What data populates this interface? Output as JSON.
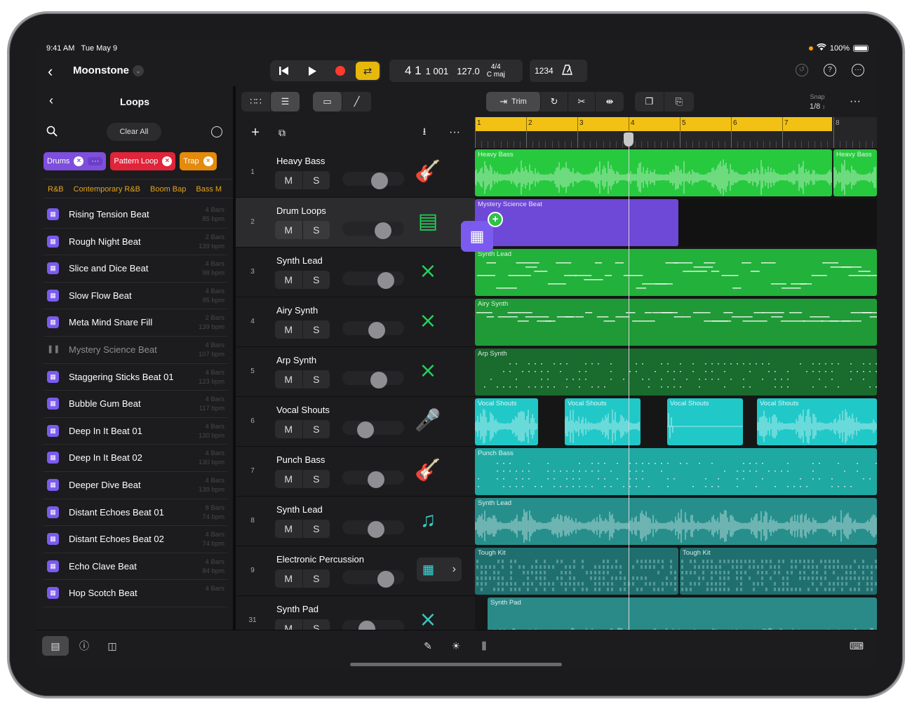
{
  "status": {
    "time": "9:41 AM",
    "date": "Tue May 9",
    "battery": "100%"
  },
  "project": {
    "title": "Moonstone"
  },
  "lcd": {
    "position": "4 1",
    "ticks": "1 001",
    "tempo": "127.0",
    "time_sig": "4/4",
    "key": "C maj"
  },
  "count_in": "1234",
  "browser": {
    "title": "Loops",
    "clear_label": "Clear All",
    "tags": [
      {
        "label": "Drums",
        "color": "#7d4fdc"
      },
      {
        "label": "Pattern Loop",
        "color": "#e0243a"
      },
      {
        "label": "Trap",
        "color": "#e48a0c"
      }
    ],
    "genres": [
      "R&B",
      "Contemporary R&B",
      "Boom Bap",
      "Bass M"
    ],
    "loops": [
      {
        "name": "Rising Tension Beat",
        "bars": "4 Bars",
        "bpm": "85 bpm"
      },
      {
        "name": "Rough Night Beat",
        "bars": "2 Bars",
        "bpm": "139 bpm"
      },
      {
        "name": "Slice and Dice Beat",
        "bars": "4 Bars",
        "bpm": "98 bpm"
      },
      {
        "name": "Slow Flow Beat",
        "bars": "4 Bars",
        "bpm": "95 bpm"
      },
      {
        "name": "Meta Mind Snare Fill",
        "bars": "2 Bars",
        "bpm": "139 bpm"
      },
      {
        "name": "Mystery Science Beat",
        "bars": "4 Bars",
        "bpm": "107 bpm",
        "playing": true
      },
      {
        "name": "Staggering Sticks Beat 01",
        "bars": "4 Bars",
        "bpm": "123 bpm"
      },
      {
        "name": "Bubble Gum Beat",
        "bars": "4 Bars",
        "bpm": "117 bpm"
      },
      {
        "name": "Deep In It Beat 01",
        "bars": "4 Bars",
        "bpm": "130 bpm"
      },
      {
        "name": "Deep In It Beat 02",
        "bars": "4 Bars",
        "bpm": "130 bpm"
      },
      {
        "name": "Deeper Dive Beat",
        "bars": "4 Bars",
        "bpm": "139 bpm"
      },
      {
        "name": "Distant Echoes Beat 01",
        "bars": "8 Bars",
        "bpm": "74 bpm"
      },
      {
        "name": "Distant Echoes Beat 02",
        "bars": "4 Bars",
        "bpm": "74 bpm"
      },
      {
        "name": "Echo Clave Beat",
        "bars": "4 Bars",
        "bpm": "84 bpm"
      },
      {
        "name": "Hop Scotch Beat",
        "bars": "4 Bars",
        "bpm": ""
      }
    ]
  },
  "toolbar": {
    "trim_label": "Trim",
    "snap_label": "Snap",
    "snap_value": "1/8"
  },
  "tracks": [
    {
      "num": "1",
      "name": "Heavy Bass",
      "icon": "bass-guitar-icon",
      "vol": 0.6
    },
    {
      "num": "2",
      "name": "Drum Loops",
      "icon": "drum-machine-icon",
      "vol": 0.66
    },
    {
      "num": "3",
      "name": "Synth Lead",
      "icon": "keyboard-stand-icon",
      "vol": 0.7
    },
    {
      "num": "4",
      "name": "Airy Synth",
      "icon": "keyboard-stand-icon",
      "vol": 0.56
    },
    {
      "num": "5",
      "name": "Arp Synth",
      "icon": "keyboard-stand-icon",
      "vol": 0.59
    },
    {
      "num": "6",
      "name": "Vocal Shouts",
      "icon": "vocalist-icon",
      "vol": 0.38
    },
    {
      "num": "7",
      "name": "Punch Bass",
      "icon": "bass-guitar-icon",
      "vol": 0.55
    },
    {
      "num": "8",
      "name": "Synth Lead",
      "icon": "orchestra-icon",
      "vol": 0.55
    },
    {
      "num": "9",
      "name": "Electronic Percussion",
      "icon": "sequencer-icon",
      "vol": 0.71
    },
    {
      "num": "31",
      "name": "Synth Pad",
      "icon": "keyboard-stand-icon",
      "vol": 0.4
    }
  ],
  "ruler": {
    "bars": [
      "1",
      "2",
      "3",
      "4",
      "5",
      "6",
      "7",
      "8"
    ]
  },
  "regions": [
    {
      "label": "Heavy Bass",
      "lane": 0,
      "color": "#27c93f"
    },
    {
      "label": "Heavy Bass",
      "lane": 0,
      "color": "#27c93f"
    },
    {
      "label": "Mystery Science Beat",
      "lane": 1,
      "color": "#6e48d6"
    },
    {
      "label": "Synth Lead",
      "lane": 2,
      "color": "#22b13a"
    },
    {
      "label": "Airy Synth",
      "lane": 3,
      "color": "#1f9a36"
    },
    {
      "label": "Arp Synth",
      "lane": 4,
      "color": "#1a6b2e"
    },
    {
      "label": "Vocal Shouts",
      "lane": 5,
      "color": "#21c8c8"
    },
    {
      "label": "Vocal Shouts",
      "lane": 5,
      "color": "#21c8c8"
    },
    {
      "label": "Vocal Shouts",
      "lane": 5,
      "color": "#21c8c8"
    },
    {
      "label": "Vocal Shouts",
      "lane": 5,
      "color": "#21c8c8"
    },
    {
      "label": "Punch Bass",
      "lane": 6,
      "color": "#1fa9a3"
    },
    {
      "label": "Synth Lead",
      "lane": 7,
      "color": "#268f8c"
    },
    {
      "label": "Tough Kit",
      "lane": 8,
      "color": "#1f6f6e"
    },
    {
      "label": "Tough Kit",
      "lane": 8,
      "color": "#1f6f6e"
    },
    {
      "label": "Synth Pad",
      "lane": 9,
      "color": "#2a8a88"
    }
  ]
}
